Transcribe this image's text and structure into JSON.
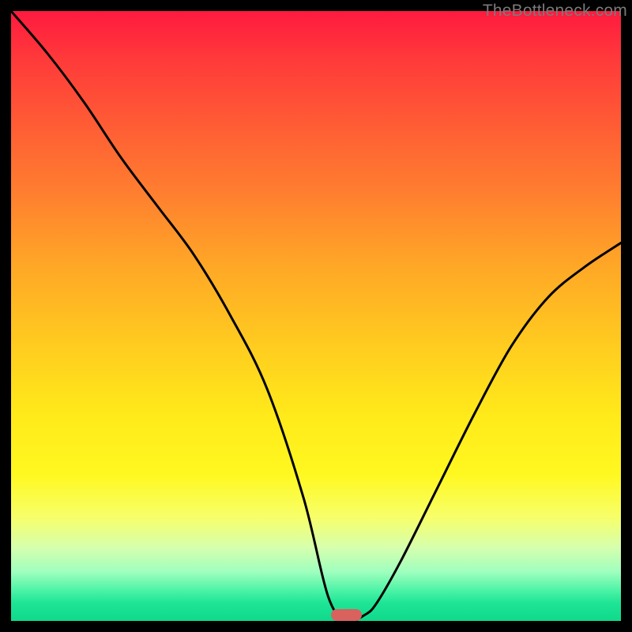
{
  "watermark": "TheBottleneck.com",
  "chart_data": {
    "type": "line",
    "title": "",
    "xlabel": "",
    "ylabel": "",
    "xlim": [
      0,
      100
    ],
    "ylim": [
      0,
      100
    ],
    "grid": false,
    "legend": false,
    "series": [
      {
        "name": "bottleneck-curve",
        "x": [
          0,
          6,
          12,
          18,
          24,
          30,
          36,
          42,
          48,
          52,
          55,
          58,
          60,
          64,
          70,
          76,
          82,
          88,
          94,
          100
        ],
        "values": [
          100,
          93,
          85,
          76,
          68,
          60,
          50,
          38,
          20,
          4,
          0,
          1,
          3,
          10,
          22,
          34,
          45,
          53,
          58,
          62
        ]
      }
    ],
    "marker": {
      "x": 55,
      "y": 0,
      "width": 5,
      "height": 2,
      "color": "#d9625e"
    }
  }
}
